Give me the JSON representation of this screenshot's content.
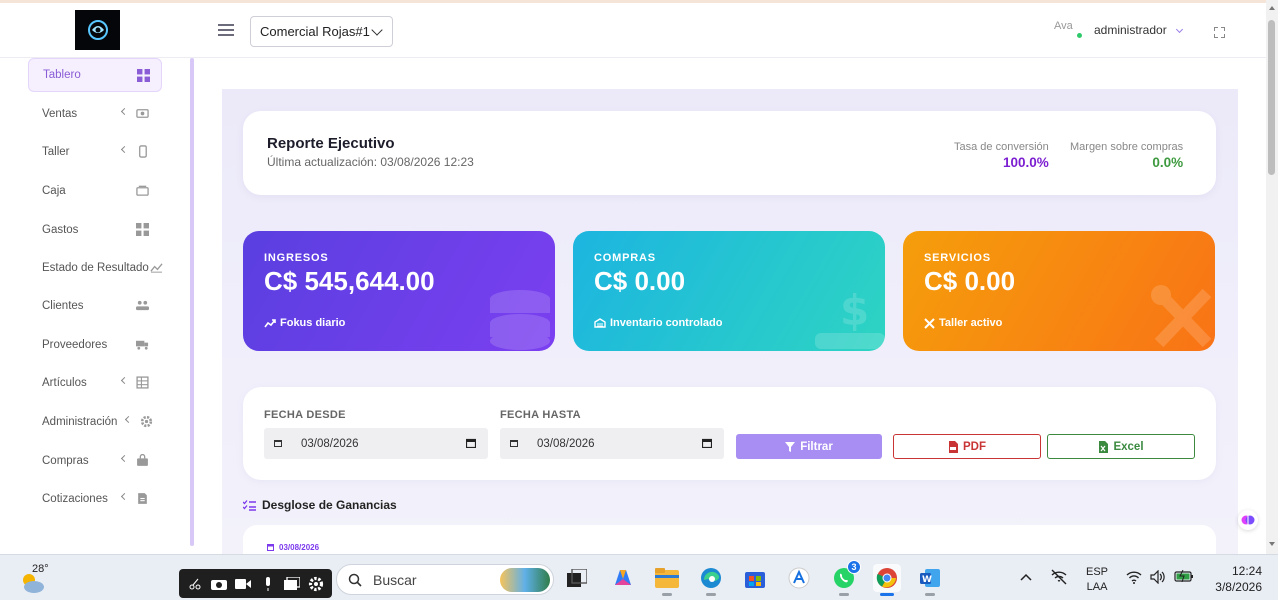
{
  "header": {
    "store_select": "Comercial Rojas#1",
    "avatar_alt": "Ava",
    "user_name": "administrador"
  },
  "sidebar": {
    "items": [
      {
        "label": "Tablero"
      },
      {
        "label": "Ventas"
      },
      {
        "label": "Taller"
      },
      {
        "label": "Caja"
      },
      {
        "label": "Gastos"
      },
      {
        "label": "Estado de Resultado"
      },
      {
        "label": "Clientes"
      },
      {
        "label": "Proveedores"
      },
      {
        "label": "Artículos"
      },
      {
        "label": "Administración"
      },
      {
        "label": "Compras"
      },
      {
        "label": "Cotizaciones"
      }
    ]
  },
  "report": {
    "title": "Reporte Ejecutivo",
    "subtitle": "Última actualización: 03/08/2026 12:23",
    "conversion_label": "Tasa de conversión",
    "conversion_value": "100.0%",
    "margin_label": "Margen sobre compras",
    "margin_value": "0.0%"
  },
  "stats": {
    "ingresos": {
      "caption": "INGRESOS",
      "amount": "C$ 545,644.00",
      "footer": "Fokus diario"
    },
    "compras": {
      "caption": "COMPRAS",
      "amount": "C$ 0.00",
      "footer": "Inventario controlado"
    },
    "servicios": {
      "caption": "SERVICIOS",
      "amount": "C$ 0.00",
      "footer": "Taller activo"
    }
  },
  "filters": {
    "from_label": "FECHA DESDE",
    "from_value": "03/08/2026",
    "to_label": "FECHA HASTA",
    "to_value": "03/08/2026",
    "filter_button": "Filtrar",
    "pdf_button": "PDF",
    "excel_button": "Excel"
  },
  "breakdown": {
    "title": "Desglose de Ganancias",
    "date": "03/08/2026"
  },
  "colors": {
    "accent": "#8a5cd6",
    "conversion": "#7c1fd1",
    "margin": "#3e9a3f",
    "ingresos_from": "#5a3fe0",
    "ingresos_to": "#7b3ff0",
    "compras_from": "#1cb5e0",
    "compras_to": "#2ed4c2",
    "servicios_from": "#f59e0b",
    "servicios_to": "#f97316"
  },
  "taskbar": {
    "weather_temp": "28°",
    "search_placeholder": "Buscar",
    "whatsapp_badge": "3",
    "lang_line1": "ESP",
    "lang_line2": "LAA",
    "time": "12:24",
    "date": "3/8/2026"
  }
}
